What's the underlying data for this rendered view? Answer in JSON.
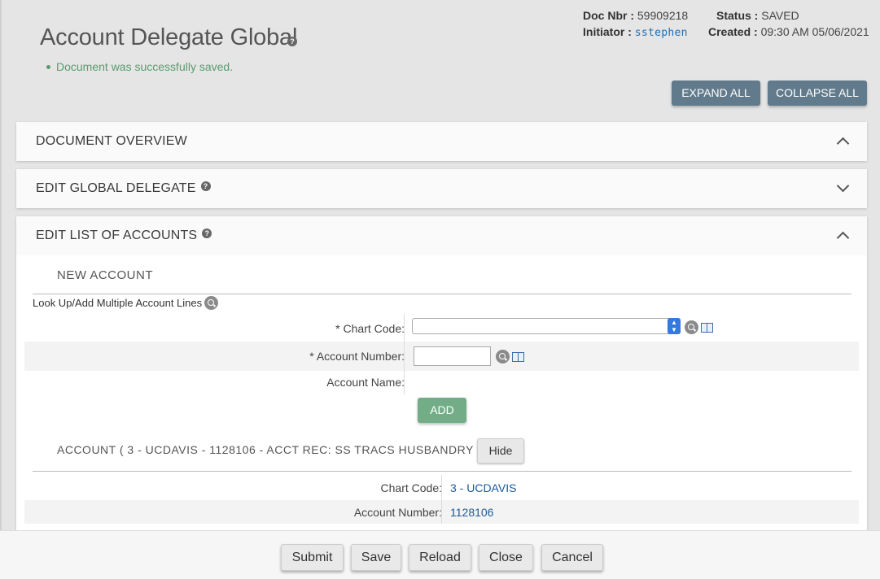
{
  "page": {
    "title": "Account Delegate Global",
    "success_message": "Document was successfully saved."
  },
  "doc_info": {
    "doc_nbr_label": "Doc Nbr :",
    "doc_nbr": "59909218",
    "initiator_label": "Initiator :",
    "initiator": "sstephen",
    "status_label": "Status :",
    "status": "SAVED",
    "created_label": "Created :",
    "created": "09:30 AM 05/06/2021"
  },
  "toolbar": {
    "expand_all": "EXPAND ALL",
    "collapse_all": "COLLAPSE ALL"
  },
  "sections": {
    "overview": "DOCUMENT OVERVIEW",
    "global_delegate": "EDIT GLOBAL DELEGATE",
    "list_of_accounts": "EDIT LIST OF ACCOUNTS"
  },
  "new_account": {
    "title": "NEW ACCOUNT",
    "lookup_label": "Look Up/Add Multiple Account Lines",
    "chart_code_label": "* Chart Code:",
    "chart_code_value": "",
    "account_number_label": "* Account Number:",
    "account_number_value": "",
    "account_name_label": "Account Name:",
    "add_label": "ADD"
  },
  "account": {
    "title": "ACCOUNT ( 3 - UCDAVIS - 1128106 - ACCT REC: SS TRACS HUSBANDRY )",
    "hide_label": "Hide",
    "chart_code_label": "Chart Code:",
    "chart_code": "3 - UCDAVIS",
    "account_number_label": "Account Number:",
    "account_number": "1128106"
  },
  "footer": {
    "submit": "Submit",
    "save": "Save",
    "reload": "Reload",
    "close": "Close",
    "cancel": "Cancel"
  },
  "colors": {
    "primary_button": "#627b8c",
    "add_button": "#72ad87",
    "success_text": "#5a9b6d",
    "link": "#1e6fb8"
  }
}
